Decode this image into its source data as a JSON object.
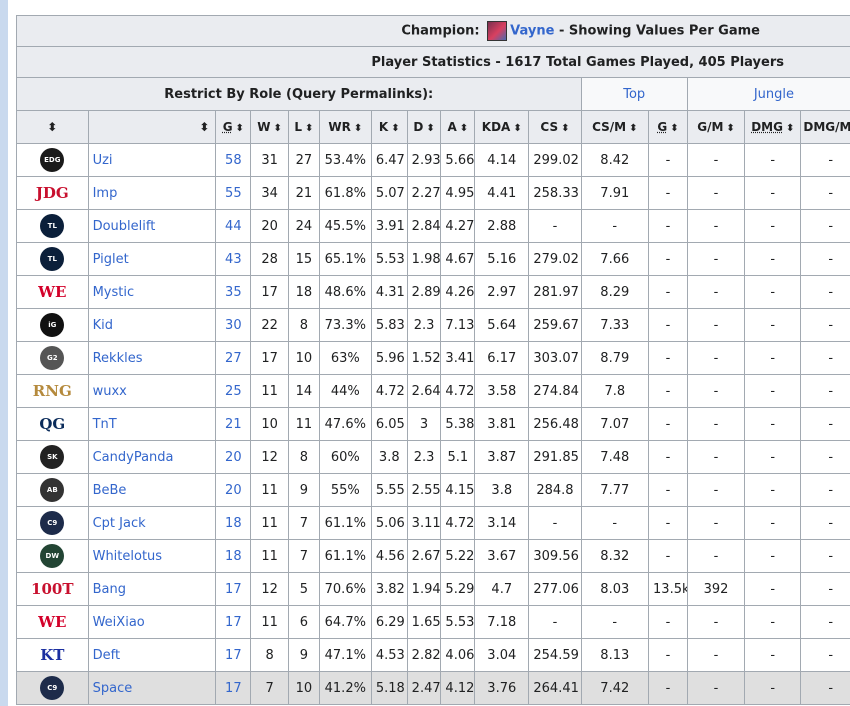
{
  "header": {
    "champion_label": "Champion:",
    "champion_name": "Vayne",
    "champion_suffix": " - Showing Values Per Game",
    "stats_title": "Player Statistics - 1617 Total Games Played, 405 Players",
    "role_label": "Restrict By Role (Query Permalinks):",
    "role_links": [
      "Top",
      "Jungle"
    ]
  },
  "columns": [
    "",
    "",
    "G",
    "W",
    "L",
    "WR",
    "K",
    "D",
    "A",
    "KDA",
    "CS",
    "CS/M",
    "G",
    "G/M",
    "DMG",
    "DMG/M"
  ],
  "sort_arrow": "⬍",
  "rows": [
    {
      "team_logo": "EDG",
      "player": "Uzi",
      "g": "58",
      "w": "31",
      "l": "27",
      "wr": "53.4%",
      "k": "6.47",
      "d": "2.93",
      "a": "5.66",
      "kda": "4.14",
      "cs": "299.02",
      "csm": "8.42",
      "gold": "-",
      "gm": "-",
      "dmg": "-",
      "dmgm": "-"
    },
    {
      "team_logo": "JDG",
      "player": "Imp",
      "g": "55",
      "w": "34",
      "l": "21",
      "wr": "61.8%",
      "k": "5.07",
      "d": "2.27",
      "a": "4.95",
      "kda": "4.41",
      "cs": "258.33",
      "csm": "7.91",
      "gold": "-",
      "gm": "-",
      "dmg": "-",
      "dmgm": "-"
    },
    {
      "team_logo": "TL",
      "player": "Doublelift",
      "g": "44",
      "w": "20",
      "l": "24",
      "wr": "45.5%",
      "k": "3.91",
      "d": "2.84",
      "a": "4.27",
      "kda": "2.88",
      "cs": "-",
      "csm": "-",
      "gold": "-",
      "gm": "-",
      "dmg": "-",
      "dmgm": "-"
    },
    {
      "team_logo": "TL",
      "player": "Piglet",
      "g": "43",
      "w": "28",
      "l": "15",
      "wr": "65.1%",
      "k": "5.53",
      "d": "1.98",
      "a": "4.67",
      "kda": "5.16",
      "cs": "279.02",
      "csm": "7.66",
      "gold": "-",
      "gm": "-",
      "dmg": "-",
      "dmgm": "-"
    },
    {
      "team_logo": "WE",
      "player": "Mystic",
      "g": "35",
      "w": "17",
      "l": "18",
      "wr": "48.6%",
      "k": "4.31",
      "d": "2.89",
      "a": "4.26",
      "kda": "2.97",
      "cs": "281.97",
      "csm": "8.29",
      "gold": "-",
      "gm": "-",
      "dmg": "-",
      "dmgm": "-"
    },
    {
      "team_logo": "iG",
      "player": "Kid",
      "g": "30",
      "w": "22",
      "l": "8",
      "wr": "73.3%",
      "k": "5.83",
      "d": "2.3",
      "a": "7.13",
      "kda": "5.64",
      "cs": "259.67",
      "csm": "7.33",
      "gold": "-",
      "gm": "-",
      "dmg": "-",
      "dmgm": "-"
    },
    {
      "team_logo": "G2",
      "player": "Rekkles",
      "g": "27",
      "w": "17",
      "l": "10",
      "wr": "63%",
      "k": "5.96",
      "d": "1.52",
      "a": "3.41",
      "kda": "6.17",
      "cs": "303.07",
      "csm": "8.79",
      "gold": "-",
      "gm": "-",
      "dmg": "-",
      "dmgm": "-"
    },
    {
      "team_logo": "RNG",
      "player": "wuxx",
      "g": "25",
      "w": "11",
      "l": "14",
      "wr": "44%",
      "k": "4.72",
      "d": "2.64",
      "a": "4.72",
      "kda": "3.58",
      "cs": "274.84",
      "csm": "7.8",
      "gold": "-",
      "gm": "-",
      "dmg": "-",
      "dmgm": "-"
    },
    {
      "team_logo": "QG",
      "player": "TnT",
      "g": "21",
      "w": "10",
      "l": "11",
      "wr": "47.6%",
      "k": "6.05",
      "d": "3",
      "a": "5.38",
      "kda": "3.81",
      "cs": "256.48",
      "csm": "7.07",
      "gold": "-",
      "gm": "-",
      "dmg": "-",
      "dmgm": "-"
    },
    {
      "team_logo": "SK",
      "player": "CandyPanda",
      "g": "20",
      "w": "12",
      "l": "8",
      "wr": "60%",
      "k": "3.8",
      "d": "2.3",
      "a": "5.1",
      "kda": "3.87",
      "cs": "291.85",
      "csm": "7.48",
      "gold": "-",
      "gm": "-",
      "dmg": "-",
      "dmgm": "-"
    },
    {
      "team_logo": "AB",
      "player": "BeBe",
      "g": "20",
      "w": "11",
      "l": "9",
      "wr": "55%",
      "k": "5.55",
      "d": "2.55",
      "a": "4.15",
      "kda": "3.8",
      "cs": "284.8",
      "csm": "7.77",
      "gold": "-",
      "gm": "-",
      "dmg": "-",
      "dmgm": "-"
    },
    {
      "team_logo": "C9",
      "player": "Cpt Jack",
      "g": "18",
      "w": "11",
      "l": "7",
      "wr": "61.1%",
      "k": "5.06",
      "d": "3.11",
      "a": "4.72",
      "kda": "3.14",
      "cs": "-",
      "csm": "-",
      "gold": "-",
      "gm": "-",
      "dmg": "-",
      "dmgm": "-"
    },
    {
      "team_logo": "DW",
      "player": "Whitelotus",
      "g": "18",
      "w": "11",
      "l": "7",
      "wr": "61.1%",
      "k": "4.56",
      "d": "2.67",
      "a": "5.22",
      "kda": "3.67",
      "cs": "309.56",
      "csm": "8.32",
      "gold": "-",
      "gm": "-",
      "dmg": "-",
      "dmgm": "-"
    },
    {
      "team_logo": "100T",
      "player": "Bang",
      "g": "17",
      "w": "12",
      "l": "5",
      "wr": "70.6%",
      "k": "3.82",
      "d": "1.94",
      "a": "5.29",
      "kda": "4.7",
      "cs": "277.06",
      "csm": "8.03",
      "gold": "13.5k",
      "gm": "392",
      "dmg": "-",
      "dmgm": "-"
    },
    {
      "team_logo": "WE",
      "player": "WeiXiao",
      "g": "17",
      "w": "11",
      "l": "6",
      "wr": "64.7%",
      "k": "6.29",
      "d": "1.65",
      "a": "5.53",
      "kda": "7.18",
      "cs": "-",
      "csm": "-",
      "gold": "-",
      "gm": "-",
      "dmg": "-",
      "dmgm": "-"
    },
    {
      "team_logo": "KT",
      "player": "Deft",
      "g": "17",
      "w": "8",
      "l": "9",
      "wr": "47.1%",
      "k": "4.53",
      "d": "2.82",
      "a": "4.06",
      "kda": "3.04",
      "cs": "254.59",
      "csm": "8.13",
      "gold": "-",
      "gm": "-",
      "dmg": "-",
      "dmgm": "-"
    },
    {
      "team_logo": "C9",
      "player": "Space",
      "g": "17",
      "w": "7",
      "l": "10",
      "wr": "41.2%",
      "k": "5.18",
      "d": "2.47",
      "a": "4.12",
      "kda": "3.76",
      "cs": "264.41",
      "csm": "7.42",
      "gold": "-",
      "gm": "-",
      "dmg": "-",
      "dmgm": "-"
    }
  ]
}
